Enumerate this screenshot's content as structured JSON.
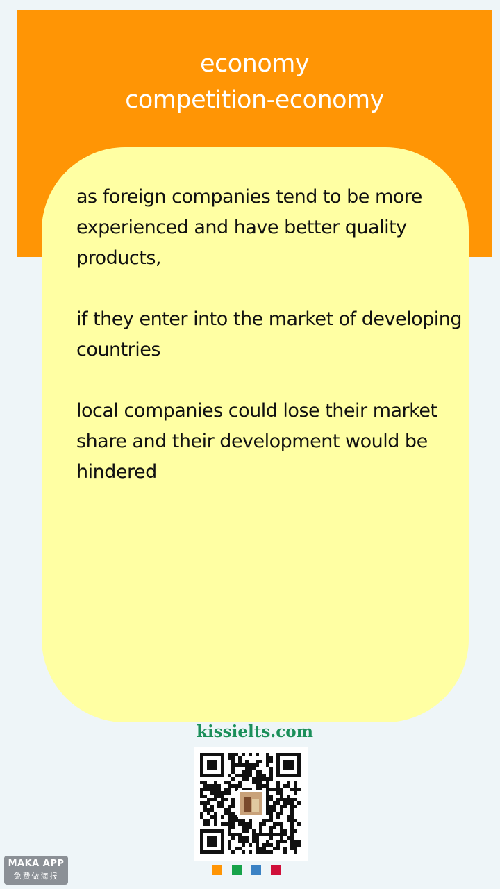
{
  "header": {
    "title_line1": "economy",
    "title_line2": "competition-economy",
    "background": "#ff9505"
  },
  "card": {
    "background": "#ffffa3",
    "paragraphs": [
      "as foreign companies tend to be more experienced and have better quality products,",
      "if they enter into the market of developing countries",
      "local companies could lose their market share and their development would be hindered"
    ]
  },
  "footer": {
    "site": "kissielts.com",
    "qr_label": "qr-code",
    "badge_line1": "MAKA APP",
    "badge_line2": "免费做海报",
    "dot_colors": [
      "#ff9505",
      "#17a34a",
      "#3b82c4",
      "#d0103a"
    ]
  }
}
